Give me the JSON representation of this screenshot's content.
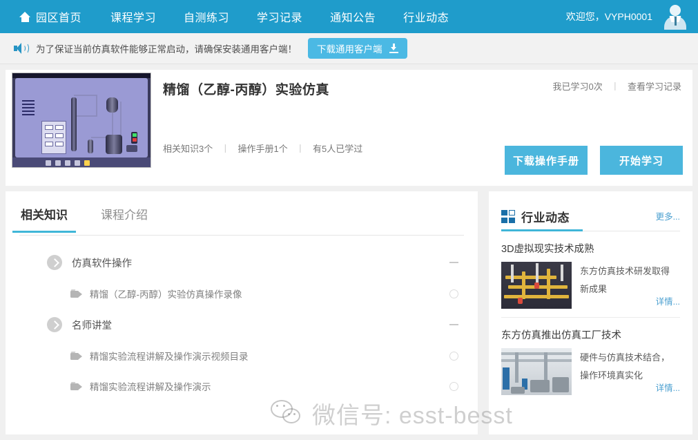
{
  "nav": {
    "home_icon": "home-icon",
    "items": [
      {
        "label": "园区首页",
        "name": "nav-home"
      },
      {
        "label": "课程学习",
        "name": "nav-courses"
      },
      {
        "label": "自测练习",
        "name": "nav-selftest"
      },
      {
        "label": "学习记录",
        "name": "nav-records"
      },
      {
        "label": "通知公告",
        "name": "nav-notices"
      },
      {
        "label": "行业动态",
        "name": "nav-industry"
      }
    ],
    "welcome": "欢迎您，VYPH0001",
    "avatar_icon": "user-avatar-icon",
    "bg_color": "#1f9ccb"
  },
  "notice": {
    "speaker_icon": "speaker-icon",
    "text": "为了保证当前仿真软件能够正常启动，请确保安装通用客户端！",
    "button_label": "下载通用客户端",
    "button_icon": "download-icon",
    "button_color": "#4bb9e4"
  },
  "course": {
    "thumbnail_name": "course-thumbnail",
    "title": "精馏（乙醇-丙醇）实验仿真",
    "meta": {
      "knowledge": "相关知识3个",
      "manual": "操作手册1个",
      "learners": "有5人已学过",
      "separator": "丨"
    },
    "study_info": {
      "count": "我已学习0次",
      "separator": "丨",
      "record_link": "查看学习记录"
    },
    "buttons": [
      {
        "label": "下载操作手册",
        "name": "download-manual-button"
      },
      {
        "label": "开始学习",
        "name": "start-study-button"
      }
    ],
    "button_color": "#4bb6dd"
  },
  "tabs": [
    {
      "label": "相关知识",
      "name": "tab-related-knowledge",
      "active": true
    },
    {
      "label": "课程介绍",
      "name": "tab-course-intro",
      "active": false
    }
  ],
  "tab_accent_color": "#3fb6d8",
  "tree": [
    {
      "label": "仿真软件操作",
      "type": "group",
      "marker": "minus",
      "children": [
        {
          "label": "精馏（乙醇-丙醇）实验仿真操作录像",
          "marker": "circle",
          "icon": "video-icon"
        }
      ]
    },
    {
      "label": "名师讲堂",
      "type": "group",
      "marker": "minus",
      "children": [
        {
          "label": "精馏实验流程讲解及操作演示视频目录",
          "marker": "circle",
          "icon": "video-icon"
        },
        {
          "label": "精馏实验流程讲解及操作演示",
          "marker": "circle",
          "icon": "video-icon"
        }
      ]
    }
  ],
  "sidebar": {
    "icon": "grid-squares-icon",
    "title": "行业动态",
    "more_label": "更多...",
    "accent_color": "#3fb6d8",
    "news": [
      {
        "title": "3D虚拟现实技术成熟",
        "desc_line1": "东方仿真技术研发取得",
        "desc_line2": "新成果",
        "detail_label": "详情...",
        "thumb_name": "news-thumbnail-industrial-plant"
      },
      {
        "title": "东方仿真推出仿真工厂技术",
        "desc_line1": "硬件与仿真技术结合，",
        "desc_line2": "操作环境真实化",
        "detail_label": "详情...",
        "thumb_name": "news-thumbnail-factory-interior"
      }
    ]
  },
  "watermark": {
    "text": "微信号: esst-besst",
    "logo": "wechat-logo-icon"
  }
}
